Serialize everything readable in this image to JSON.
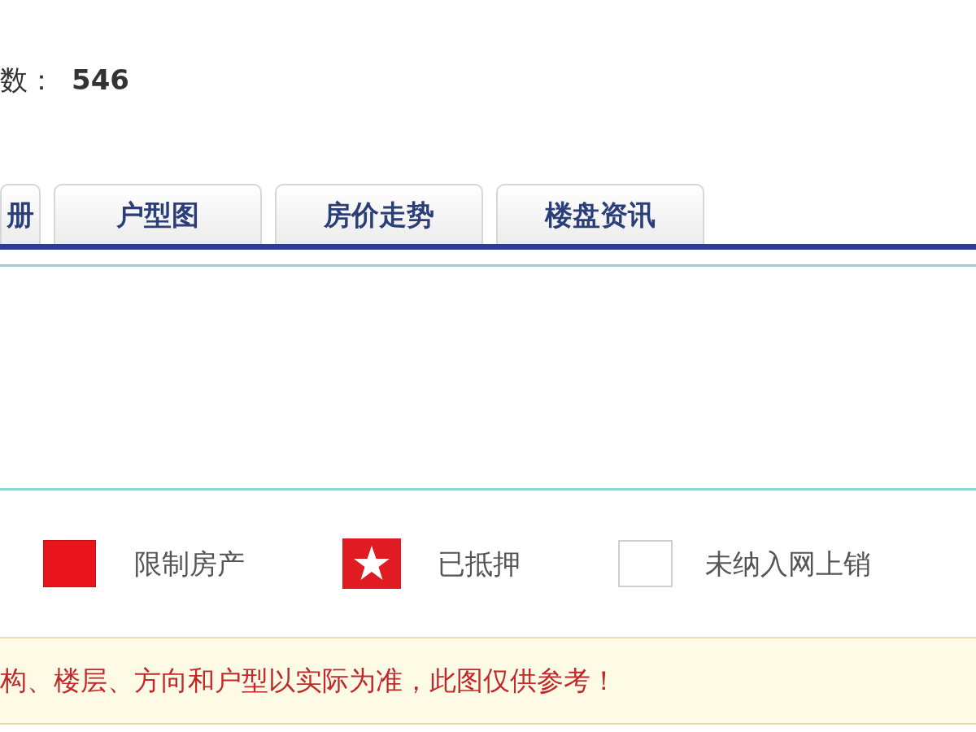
{
  "summary": {
    "label": "数：",
    "value": "546"
  },
  "tabs": [
    {
      "label": "册"
    },
    {
      "label": "户型图"
    },
    {
      "label": "房价走势"
    },
    {
      "label": "楼盘资讯"
    }
  ],
  "legend": [
    {
      "kind": "restricted",
      "label": "限制房产"
    },
    {
      "kind": "mortgaged",
      "label": "已抵押"
    },
    {
      "kind": "unlisted",
      "label": "未纳入网上销"
    }
  ],
  "notice": "构、楼层、方向和户型以实际为准，此图仅供参考！"
}
